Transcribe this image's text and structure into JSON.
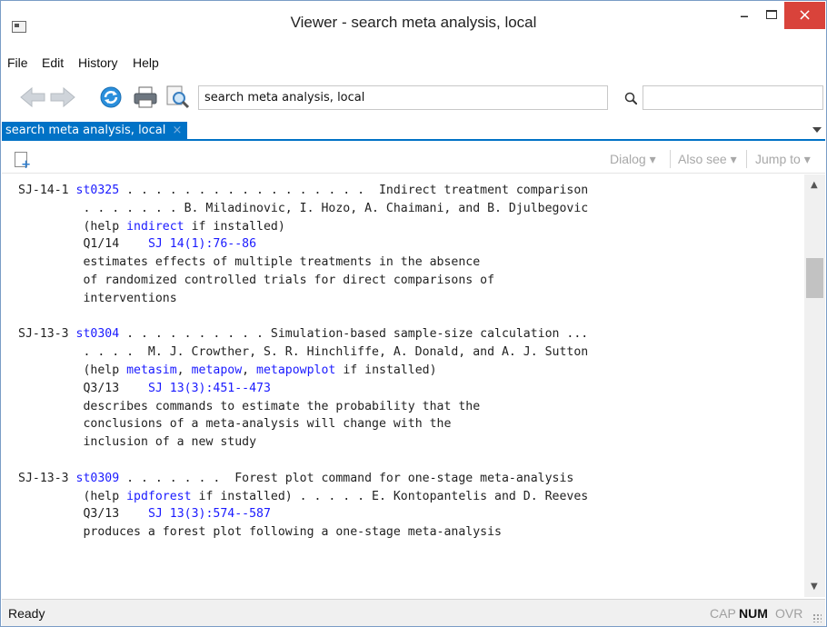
{
  "window": {
    "title": "Viewer - search meta analysis, local",
    "close_symbol": "×",
    "minimize_symbol": "–"
  },
  "menu": [
    {
      "label": "File"
    },
    {
      "label": "Edit"
    },
    {
      "label": "History"
    },
    {
      "label": "Help"
    }
  ],
  "toolbar": {
    "address_value": "search meta analysis, local",
    "find_placeholder": ""
  },
  "tab": {
    "label": "search meta analysis, local",
    "close_symbol": "×"
  },
  "subbar": {
    "dialog": "Dialog ▾",
    "also_see": "Also see ▾",
    "jump_to": "Jump to ▾"
  },
  "results": [
    {
      "id": "SJ-14-1",
      "code": "st0325",
      "header_tail": " . . . . . . . . . . . . . . . . .  Indirect treatment comparison",
      "authors_line": "         . . . . . . . B. Miladinovic, I. Hozo, A. Chaimani, and B. Djulbegovic",
      "help_prefix": "         (help ",
      "help_links": [
        "indirect"
      ],
      "help_suffix": " if installed)",
      "issue": "Q1/14",
      "ref": "SJ 14(1):76--86",
      "description": [
        "estimates effects of multiple treatments in the absence",
        "of randomized controlled trials for direct comparisons of",
        "interventions"
      ]
    },
    {
      "id": "SJ-13-3",
      "code": "st0304",
      "header_tail": " . . . . . . . . . . Simulation-based sample-size calculation ...",
      "authors_line": "         . . . .  M. J. Crowther, S. R. Hinchliffe, A. Donald, and A. J. Sutton",
      "help_prefix": "         (help ",
      "help_links": [
        "metasim",
        "metapow",
        "metapowplot"
      ],
      "help_suffix": " if installed)",
      "issue": "Q3/13",
      "ref": "SJ 13(3):451--473",
      "description": [
        "describes commands to estimate the probability that the",
        "conclusions of a meta-analysis will change with the",
        "inclusion of a new study"
      ]
    },
    {
      "id": "SJ-13-3",
      "code": "st0309",
      "header_tail": " . . . . . . .  Forest plot command for one-stage meta-analysis",
      "help_prefix": "         (help ",
      "help_links": [
        "ipdforest"
      ],
      "help_suffix": " if installed) . . . . . E. Kontopantelis and D. Reeves",
      "issue": "Q3/13",
      "ref": "SJ 13(3):574--587",
      "description": [
        "produces a forest plot following a one-stage meta-analysis"
      ]
    }
  ],
  "status": {
    "text": "Ready",
    "cap": "CAP",
    "num": "NUM",
    "ovr": "OVR"
  },
  "icons": [
    "back-arrow-icon",
    "forward-arrow-icon",
    "refresh-icon",
    "print-icon",
    "find-in-page-icon",
    "search-icon",
    "new-viewer-icon"
  ]
}
